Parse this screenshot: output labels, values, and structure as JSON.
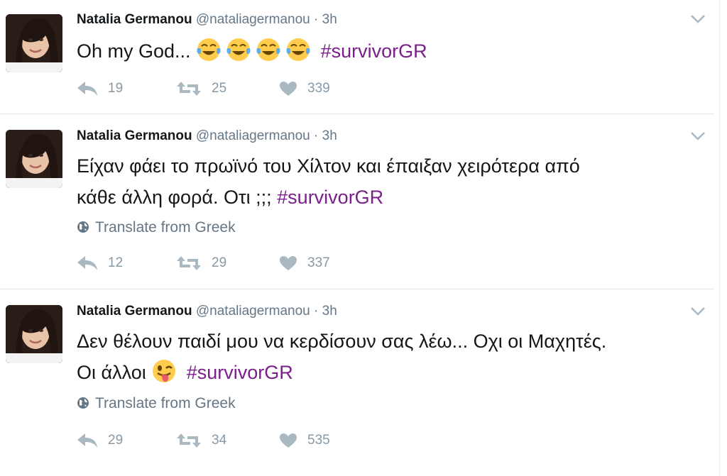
{
  "tweets": [
    {
      "name": "Natalia Germanou",
      "handle": "@nataliagermanou",
      "separator": "·",
      "time": "3h",
      "text": "Oh my God...",
      "emojis": [
        "face-with-tears-of-joy",
        "face-with-tears-of-joy",
        "face-with-tears-of-joy",
        "face-with-tears-of-joy"
      ],
      "hashtag": "#survivorGR",
      "translate": "",
      "replies": "19",
      "retweets": "25",
      "likes": "339"
    },
    {
      "name": "Natalia Germanou",
      "handle": "@nataliagermanou",
      "separator": "·",
      "time": "3h",
      "text_line1": "Είχαν φάει το πρωϊνό του Χίλτον και έπαιξαν χειρότερα από",
      "text_line2": "κάθε άλλη φορά. Οτι ;;;",
      "hashtag": "#survivorGR",
      "translate": "Translate from Greek",
      "replies": "12",
      "retweets": "29",
      "likes": "337"
    },
    {
      "name": "Natalia Germanou",
      "handle": "@nataliagermanou",
      "separator": "·",
      "time": "3h",
      "text_line1": "Δεν θέλουν παιδί μου να κερδίσουν σας λέω... Οχι οι Μαχητές.",
      "text_line2": "Οι άλλοι",
      "emojis": [
        "winking-face-with-tongue"
      ],
      "hashtag": "#survivorGR",
      "translate": "Translate from Greek",
      "replies": "29",
      "retweets": "34",
      "likes": "535"
    }
  ],
  "colors": {
    "hashtag": "#7b1f8c",
    "muted": "#657786",
    "icon": "#aab8c2",
    "text": "#14171a",
    "divider": "#e1e8ed"
  },
  "icons": [
    "reply-icon",
    "retweet-icon",
    "like-icon",
    "globe-icon",
    "chevron-down-icon"
  ]
}
